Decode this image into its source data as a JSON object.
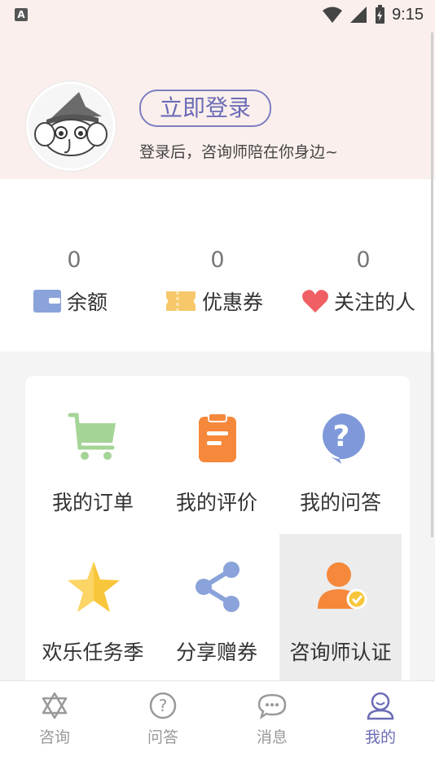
{
  "status_bar": {
    "time": "9:15",
    "app_icon_letter": "A"
  },
  "profile": {
    "login_button": "立即登录",
    "login_tip": "登录后，咨询师陪在你身边~",
    "avatar_icon": "elephant-wizard-avatar"
  },
  "stats": [
    {
      "value": "0",
      "label": "余额",
      "icon": "wallet-icon",
      "color": "#8aa3da"
    },
    {
      "value": "0",
      "label": "优惠券",
      "icon": "ticket-icon",
      "color": "#f6c86a"
    },
    {
      "value": "0",
      "label": "关注的人",
      "icon": "heart-icon",
      "color": "#ef5f63"
    }
  ],
  "menu": [
    {
      "label": "我的订单",
      "icon": "cart-icon",
      "color": "#a5d497"
    },
    {
      "label": "我的评价",
      "icon": "clipboard-icon",
      "color": "#f5883a"
    },
    {
      "label": "我的问答",
      "icon": "question-bubble-icon",
      "color": "#7f98d9"
    },
    {
      "label": "欢乐任务季",
      "icon": "star-icon",
      "color": "#f8c63a"
    },
    {
      "label": "分享赠券",
      "icon": "share-icon",
      "color": "#8aa3da"
    },
    {
      "label": "咨询师认证",
      "icon": "counselor-verified-icon",
      "color": "#f5883a"
    }
  ],
  "tabbar": [
    {
      "label": "咨询",
      "icon": "star-of-david-icon",
      "active": false
    },
    {
      "label": "问答",
      "icon": "question-circle-icon",
      "active": false
    },
    {
      "label": "消息",
      "icon": "chat-bubble-icon",
      "active": false
    },
    {
      "label": "我的",
      "icon": "user-face-icon",
      "active": true
    }
  ],
  "colors": {
    "accent": "#6b6cb6",
    "header_bg": "#faefec"
  }
}
